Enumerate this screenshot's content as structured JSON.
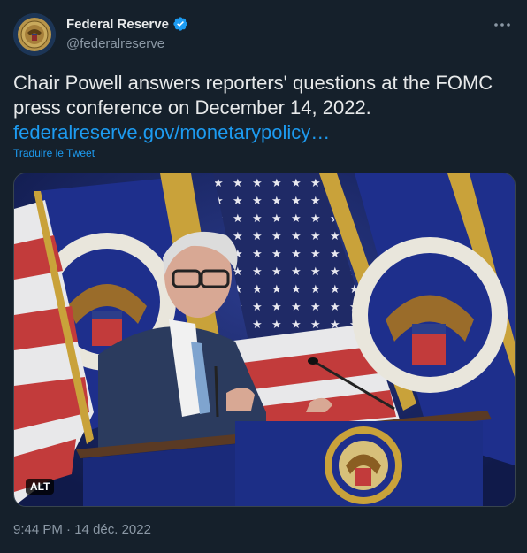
{
  "account": {
    "name": "Federal Reserve",
    "handle": "@federalreserve"
  },
  "tweet": {
    "text": "Chair Powell answers reporters' questions at the FOMC press conference on December 14, 2022.",
    "link": "federalreserve.gov/monetarypolicy…",
    "translate": "Traduire le Tweet",
    "alt_badge": "ALT",
    "time": "9:44 PM",
    "separator": "·",
    "date": "14 déc. 2022"
  },
  "colors": {
    "background": "#15202b",
    "accent": "#1d9bf0",
    "muted": "#8b98a5"
  },
  "icons": [
    "fed-seal-avatar",
    "verified-badge-icon",
    "more-options-icon"
  ]
}
